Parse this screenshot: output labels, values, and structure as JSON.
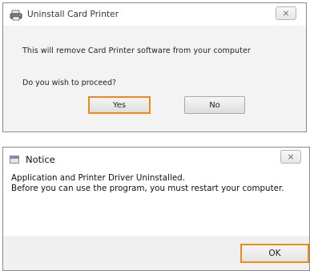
{
  "uninstall_dialog": {
    "title": "Uninstall Card Printer",
    "message": "This will remove Card Printer software from your computer",
    "question": "Do you wish to proceed?",
    "yes_label": "Yes",
    "no_label": "No",
    "close_glyph": "⨯",
    "icon": "printer-icon"
  },
  "notice_dialog": {
    "title": "Notice",
    "line1": "Application and Printer Driver Uninstalled.",
    "line2": "Before you can use the program, you must restart your computer.",
    "ok_label": "OK",
    "close_glyph": "⨯",
    "icon": "window-icon"
  },
  "colors": {
    "highlight": "#ef8a1a"
  }
}
